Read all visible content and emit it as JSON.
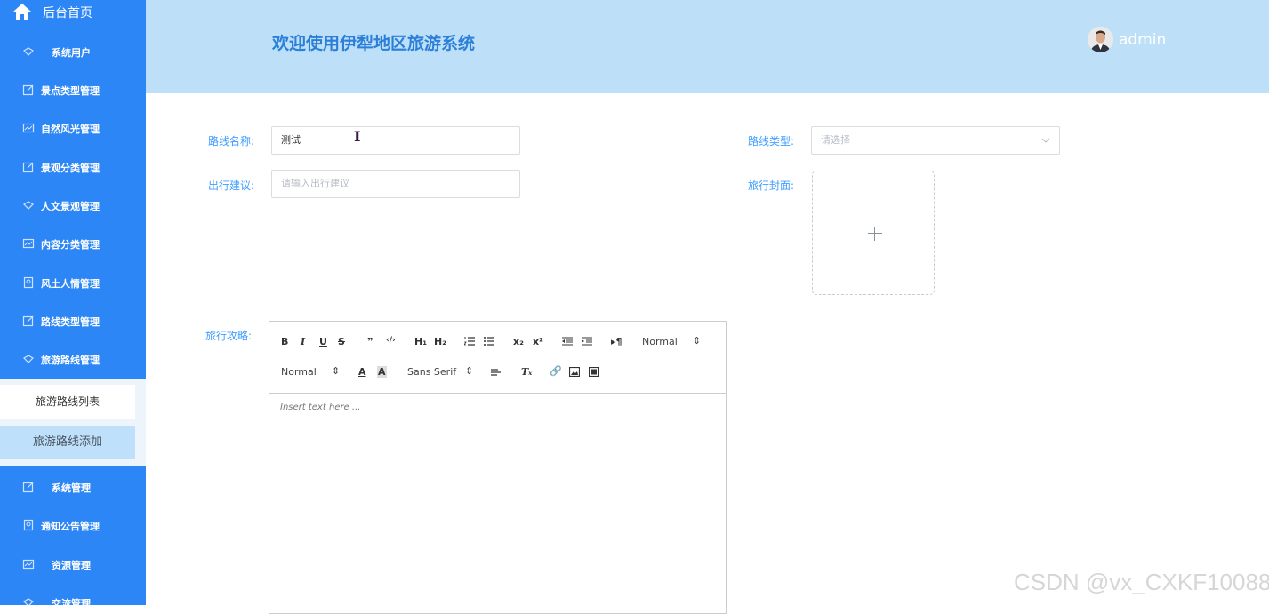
{
  "sidebar": {
    "home_label": "后台首页",
    "items": [
      {
        "label": "系统用户",
        "icon": "diamond-icon"
      },
      {
        "label": "景点类型管理",
        "icon": "edit-icon"
      },
      {
        "label": "自然风光管理",
        "icon": "chart-icon"
      },
      {
        "label": "景观分类管理",
        "icon": "edit-icon"
      },
      {
        "label": "人文景观管理",
        "icon": "diamond-icon"
      },
      {
        "label": "内容分类管理",
        "icon": "chart-icon"
      },
      {
        "label": "风土人情管理",
        "icon": "badge-icon"
      },
      {
        "label": "路线类型管理",
        "icon": "edit-icon"
      },
      {
        "label": "旅游路线管理",
        "icon": "diamond-icon"
      }
    ],
    "submenu": [
      {
        "label": "旅游路线列表"
      },
      {
        "label": "旅游路线添加"
      }
    ],
    "items_after": [
      {
        "label": "系统管理",
        "icon": "edit-icon"
      },
      {
        "label": "通知公告管理",
        "icon": "badge-icon"
      },
      {
        "label": "资源管理",
        "icon": "chart-icon"
      },
      {
        "label": "交流管理",
        "icon": "diamond-icon"
      }
    ]
  },
  "header": {
    "title": "欢迎使用伊犁地区旅游系统",
    "username": "admin"
  },
  "form": {
    "route_name_label": "路线名称:",
    "route_name_value": "测试",
    "route_type_label": "路线类型:",
    "route_type_placeholder": "请选择",
    "travel_advice_label": "出行建议:",
    "travel_advice_placeholder": "请输入出行建议",
    "cover_label": "旅行封面:",
    "guide_label": "旅行攻略:"
  },
  "editor": {
    "header_select": "Normal",
    "size_select": "Normal",
    "font_select": "Sans Serif",
    "placeholder": "Insert text here ..."
  },
  "watermark": "CSDN @vx_CXKF10088"
}
